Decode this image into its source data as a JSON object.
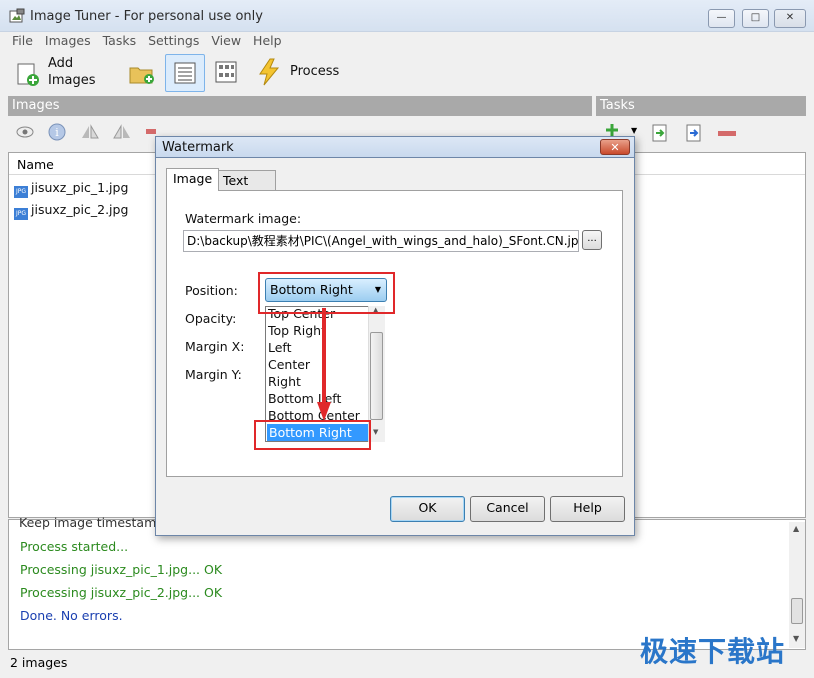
{
  "window": {
    "title": "Image Tuner - For personal use only"
  },
  "menu": [
    "File",
    "Images",
    "Tasks",
    "Settings",
    "View",
    "Help"
  ],
  "toolbar": {
    "add_line1": "Add",
    "add_line2": "Images",
    "process_label": "Process"
  },
  "images_panel": {
    "title": "Images",
    "column_name": "Name",
    "files": [
      "jisuxz_pic_1.jpg",
      "jisuxz_pic_2.jpg"
    ],
    "file_icon_text": "JPG"
  },
  "tasks_panel": {
    "title": "Tasks"
  },
  "log": {
    "partial_line": "Keep image timestamp",
    "lines": [
      {
        "text": "Process started...",
        "color": "#2b8a1e"
      },
      {
        "text": "Processing jisuxz_pic_1.jpg... OK",
        "color": "#2b8a1e"
      },
      {
        "text": "Processing jisuxz_pic_2.jpg... OK",
        "color": "#2b8a1e"
      },
      {
        "text": "Done. No errors.",
        "color": "#1a3fb0"
      }
    ]
  },
  "status": {
    "text": "2 images"
  },
  "dialog": {
    "title": "Watermark",
    "close_symbol": "✕",
    "tabs": [
      "Image",
      "Text"
    ],
    "watermark_image_label": "Watermark image:",
    "watermark_path": "D:\\backup\\教程素材\\PIC\\(Angel_with_wings_and_halo)_SFont.CN.jpg",
    "browse_label": "...",
    "position_label": "Position:",
    "opacity_label": "Opacity:",
    "margin_x_label": "Margin X:",
    "margin_y_label": "Margin Y:",
    "position_value": "Bottom Right",
    "position_options": [
      "Top Center",
      "Top Right",
      "Left",
      "Center",
      "Right",
      "Bottom Left",
      "Bottom Center",
      "Bottom Right"
    ],
    "ok_label": "OK",
    "cancel_label": "Cancel",
    "help_label": "Help"
  },
  "watermark_text": "极速下载站",
  "colors": {
    "accent": "#3399ff",
    "highlight": "#e0282a",
    "panel_header": "#a9a9a9"
  }
}
